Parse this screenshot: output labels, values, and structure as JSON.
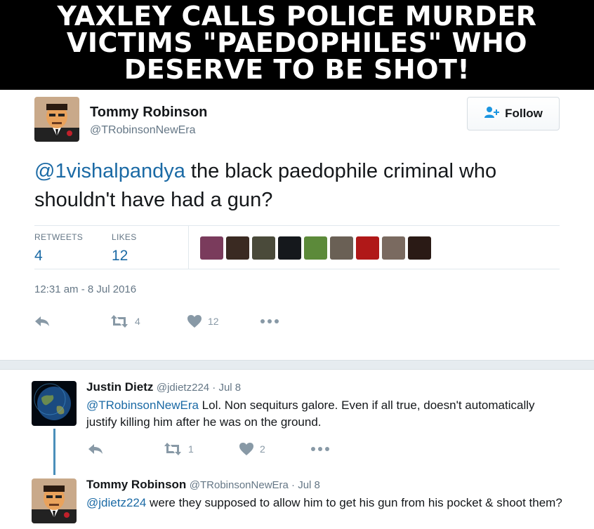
{
  "banner": {
    "lines": [
      "YAXLEY CALLS POLICE MURDER",
      "VICTIMS \"PAEDOPHILES\" WHO",
      "DESERVE TO BE SHOT!"
    ]
  },
  "tweet": {
    "author_name": "Tommy Robinson",
    "author_handle": "@TRobinsonNewEra",
    "follow_label": "Follow",
    "mention": "@1vishalpandya",
    "text": " the black paedophile criminal who shouldn't have had a gun?",
    "retweets_label": "RETWEETS",
    "retweets_count": "4",
    "likes_label": "LIKES",
    "likes_count": "12",
    "timestamp": "12:31 am - 8 Jul 2016",
    "action_retweet_count": "4",
    "action_like_count": "12",
    "liker_colors": [
      "#7a3b5c",
      "#3a2a22",
      "#4a4a3a",
      "#15181c",
      "#5c8a3a",
      "#6a6055",
      "#b01818",
      "#7a6a60",
      "#2a1a15"
    ]
  },
  "replies": [
    {
      "name": "Justin Dietz",
      "meta": "@jdietz224 · Jul 8",
      "mention": "@TRobinsonNewEra",
      "text": " Lol. Non sequiturs galore. Even if all true, doesn't automatically justify killing him after he was on the ground.",
      "retweet_count": "1",
      "like_count": "2"
    },
    {
      "name": "Tommy Robinson",
      "meta": "@TRobinsonNewEra · Jul 8",
      "mention": "@jdietz224",
      "text": " were they supposed to allow him to get his gun from his pocket & shoot them?"
    }
  ],
  "colors": {
    "link": "#1b6aa5",
    "muted": "#657786",
    "icon": "#8899a6",
    "thread_line": "#4a8fba"
  }
}
